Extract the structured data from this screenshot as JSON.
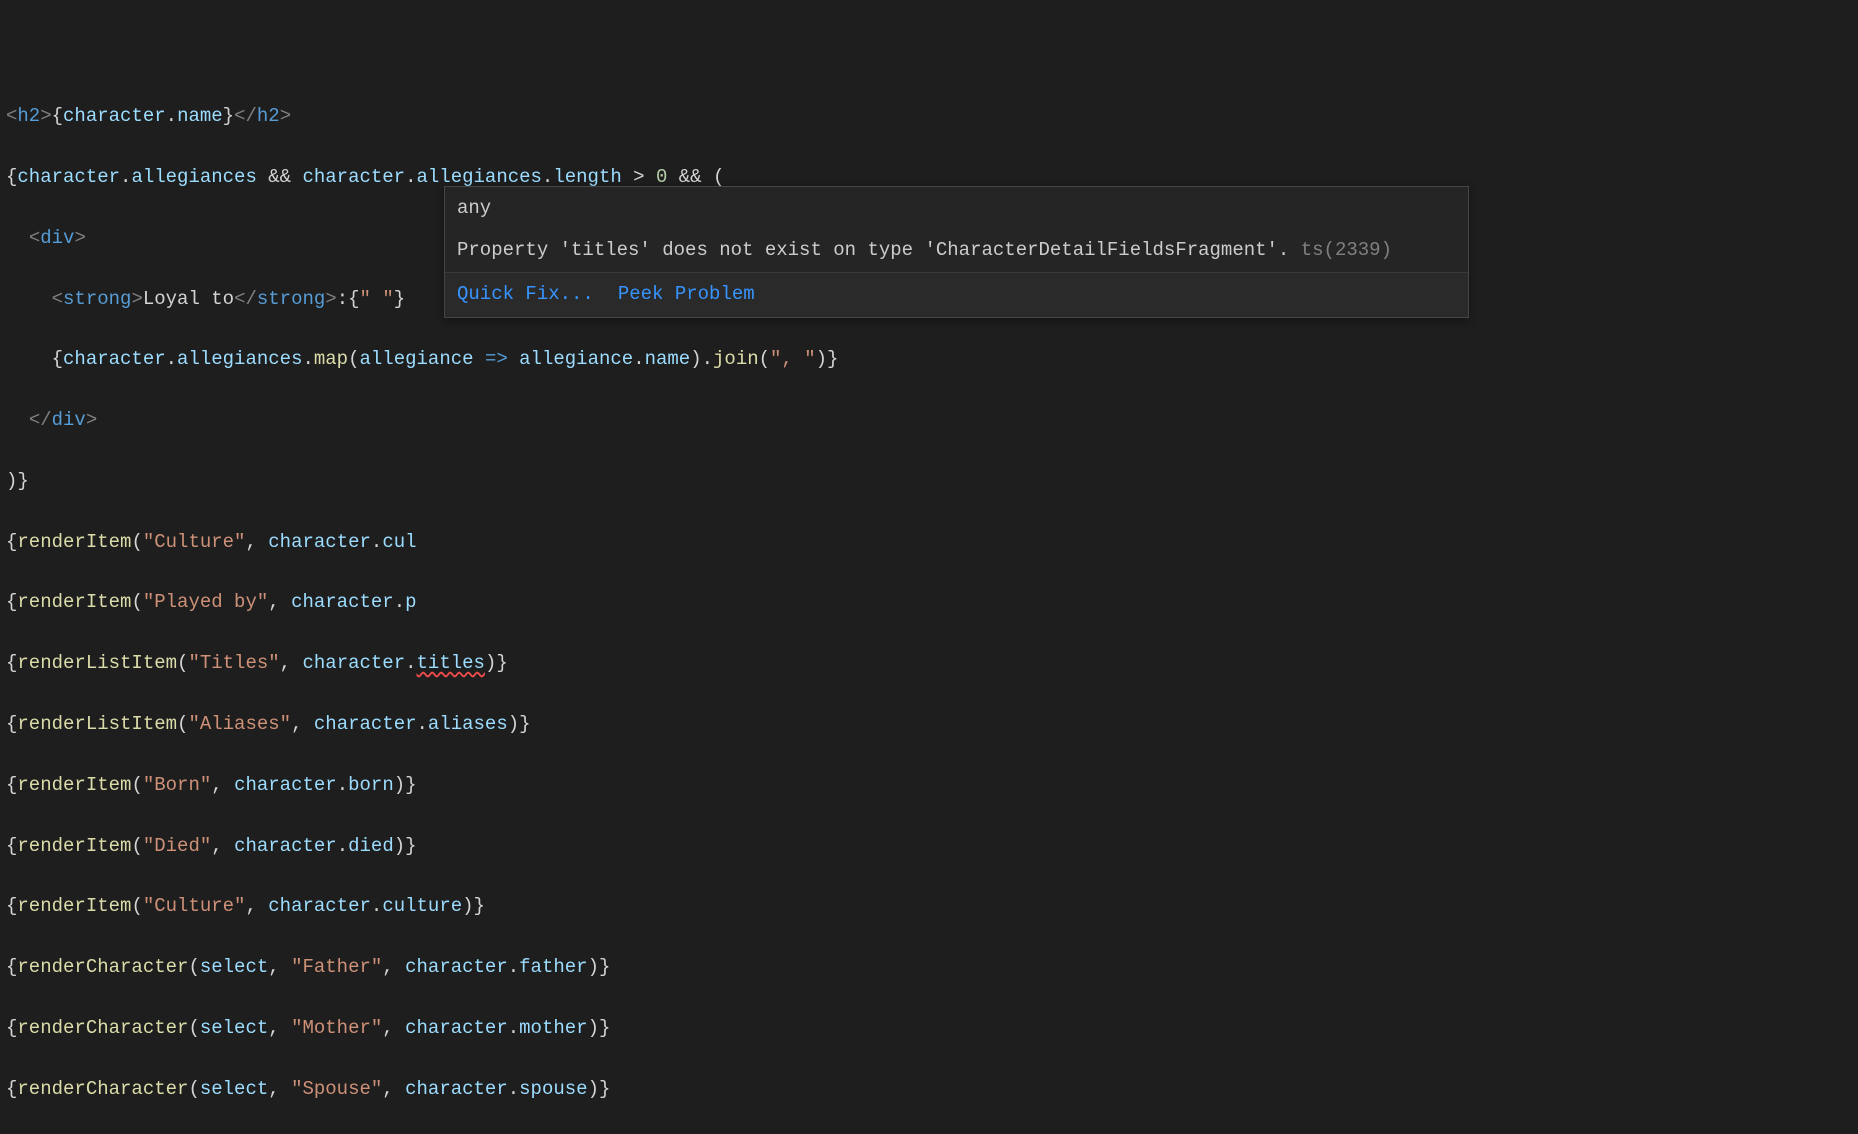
{
  "code": {
    "l1": "<h2>{character.name}</h2>",
    "l2": "{character.allegiances && character.allegiances.length > 0 && (",
    "l3": "  <div>",
    "l4": "    <strong>Loyal to</strong>:{\" \"}",
    "l5": "    {character.allegiances.map(allegiance => allegiance.name).join(\", \")}",
    "l6": "  </div>",
    "l7": ")}",
    "l8": "{renderItem(\"Culture\", character.cul",
    "l9": "{renderItem(\"Played by\", character.p",
    "l10": "{renderListItem(\"Titles\", character.titles)}",
    "l11": "{renderListItem(\"Aliases\", character.aliases)}",
    "l12": "{renderItem(\"Born\", character.born)}",
    "l13": "{renderItem(\"Died\", character.died)}",
    "l14": "{renderItem(\"Culture\", character.culture)}",
    "l15": "{renderCharacter(select, \"Father\", character.father)}",
    "l16": "{renderCharacter(select, \"Mother\", character.mother)}",
    "l17": "{renderCharacter(select, \"Spouse\", character.spouse)}"
  },
  "hover": {
    "type": "any",
    "message": "Property 'titles' does not exist on type 'CharacterDetailFieldsFragment'.",
    "errorCode": "ts(2339)",
    "quickFix": "Quick Fix...",
    "peek": "Peek Problem"
  },
  "error": {
    "token": "titles"
  }
}
